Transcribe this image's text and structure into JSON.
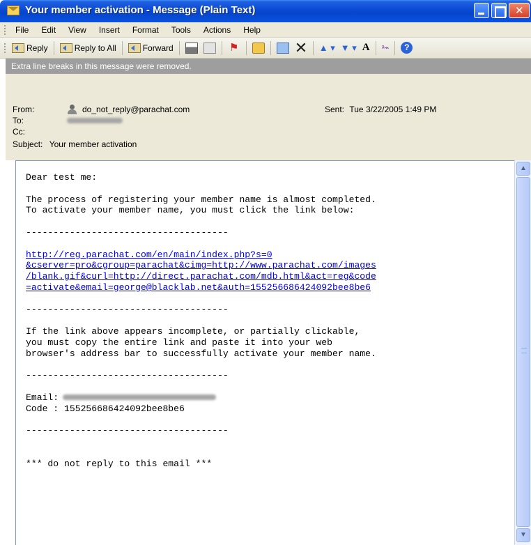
{
  "window": {
    "title": "Your member activation - Message (Plain Text)"
  },
  "menu": [
    "File",
    "Edit",
    "View",
    "Insert",
    "Format",
    "Tools",
    "Actions",
    "Help"
  ],
  "toolbar": {
    "reply": "Reply",
    "reply_all": "Reply to All",
    "forward": "Forward",
    "font_glyph": "A",
    "help_glyph": "?"
  },
  "infobar": "Extra line breaks in this message were removed.",
  "header": {
    "from_label": "From:",
    "from_value": "do_not_reply@parachat.com",
    "to_label": "To:",
    "cc_label": "Cc:",
    "subject_label": "Subject:",
    "subject_value": "Your member activation",
    "sent_label": "Sent:",
    "sent_value": "Tue 3/22/2005 1:49 PM"
  },
  "body": {
    "greeting": "Dear test me:",
    "para1_line1": "The process of registering your member name is almost completed.",
    "para1_line2": "To activate your member name, you must click the link below:",
    "divider": "-------------------------------------",
    "link_line1": "http://reg.parachat.com/en/main/index.php?s=0",
    "link_line2": "&cserver=pro&cgroup=parachat&cimg=http://www.parachat.com/images",
    "link_line3": "/blank.gif&curl=http://direct.parachat.com/mdb.html&act=reg&code",
    "link_line4": "=activate&email=george@blacklab.net&auth=155256686424092bee8be6",
    "para2_line1": "If the link above appears incomplete, or partially clickable,",
    "para2_line2": "you must copy the entire link and paste it into your web",
    "para2_line3": "browser's address bar to successfully activate your member name.",
    "email_label": "Email:",
    "code_line": "Code : 155256686424092bee8be6",
    "footer": "*** do not reply to this email ***"
  }
}
